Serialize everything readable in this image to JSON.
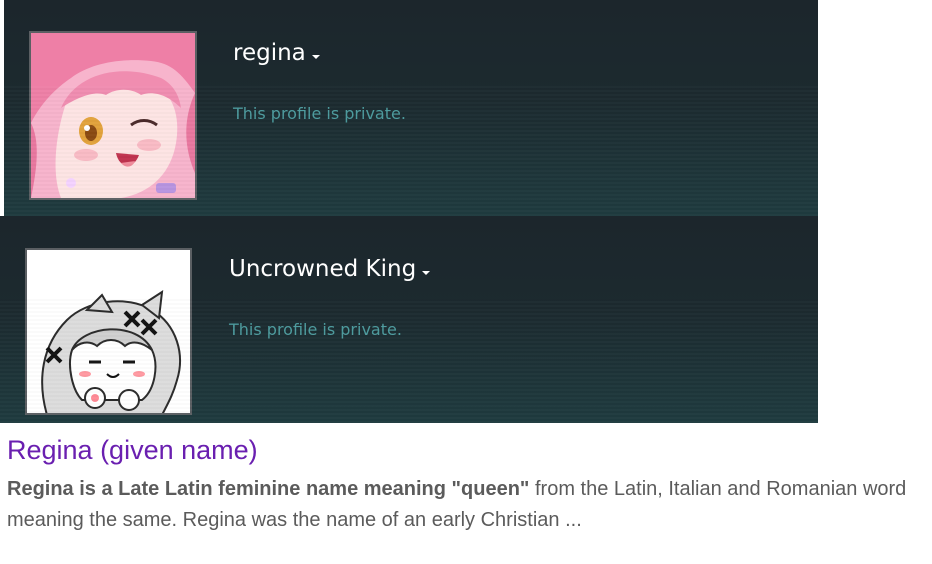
{
  "profiles": [
    {
      "name": "regina",
      "status": "This profile is private.",
      "avatar_icon": "anime-pink-hair-avatar"
    },
    {
      "name": "Uncrowned King",
      "status": "This profile is private.",
      "avatar_icon": "anime-white-hair-chibi-avatar"
    }
  ],
  "search_result": {
    "title": "Regina (given name)",
    "snippet_bold": "Regina is a Late Latin feminine name meaning \"queen\"",
    "snippet_rest": " from the Latin, Italian and Romanian word meaning the same. Regina was the name of an early Christian ..."
  },
  "colors": {
    "card_bg": "#1c262c",
    "private_text": "#4c9b9e",
    "link_visited": "#6a1fb0",
    "snippet_text": "#5b5b5b"
  }
}
